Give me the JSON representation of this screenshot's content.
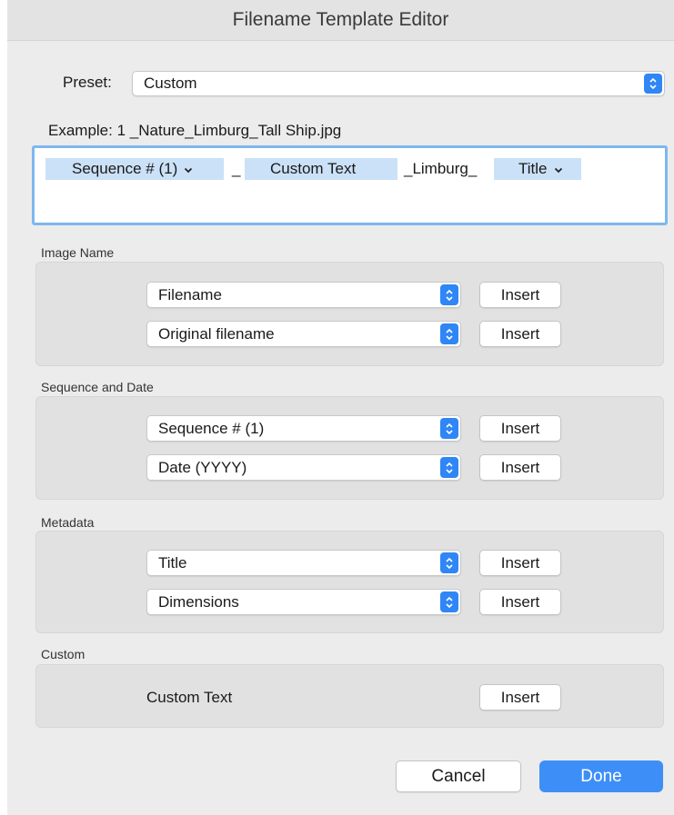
{
  "window": {
    "title": "Filename Template Editor"
  },
  "preset": {
    "label": "Preset:",
    "value": "Custom"
  },
  "example": {
    "label": "Example:",
    "value": "1 _Nature_Limburg_Tall Ship.jpg"
  },
  "template": {
    "tokens": [
      {
        "text": "Sequence # (1)",
        "kind": "dropdown-token"
      },
      {
        "text": "_",
        "kind": "literal"
      },
      {
        "text": "Custom Text",
        "kind": "token"
      },
      {
        "text": "_Limburg_",
        "kind": "literal"
      },
      {
        "text": "Title",
        "kind": "dropdown-token"
      }
    ]
  },
  "sections": {
    "image_name": {
      "label": "Image Name",
      "rows": [
        {
          "select": "Filename",
          "button": "Insert"
        },
        {
          "select": "Original filename",
          "button": "Insert"
        }
      ]
    },
    "sequence_date": {
      "label": "Sequence and Date",
      "rows": [
        {
          "select": "Sequence # (1)",
          "button": "Insert"
        },
        {
          "select": "Date (YYYY)",
          "button": "Insert"
        }
      ]
    },
    "metadata": {
      "label": "Metadata",
      "rows": [
        {
          "select": "Title",
          "button": "Insert"
        },
        {
          "select": "Dimensions",
          "button": "Insert"
        }
      ]
    },
    "custom": {
      "label": "Custom",
      "text_label": "Custom Text",
      "button": "Insert"
    }
  },
  "footer": {
    "cancel": "Cancel",
    "done": "Done"
  },
  "colors": {
    "accent": "#3d8ff7",
    "token_bg": "#cbe1f7",
    "focus_ring": "#7eb7ee"
  }
}
